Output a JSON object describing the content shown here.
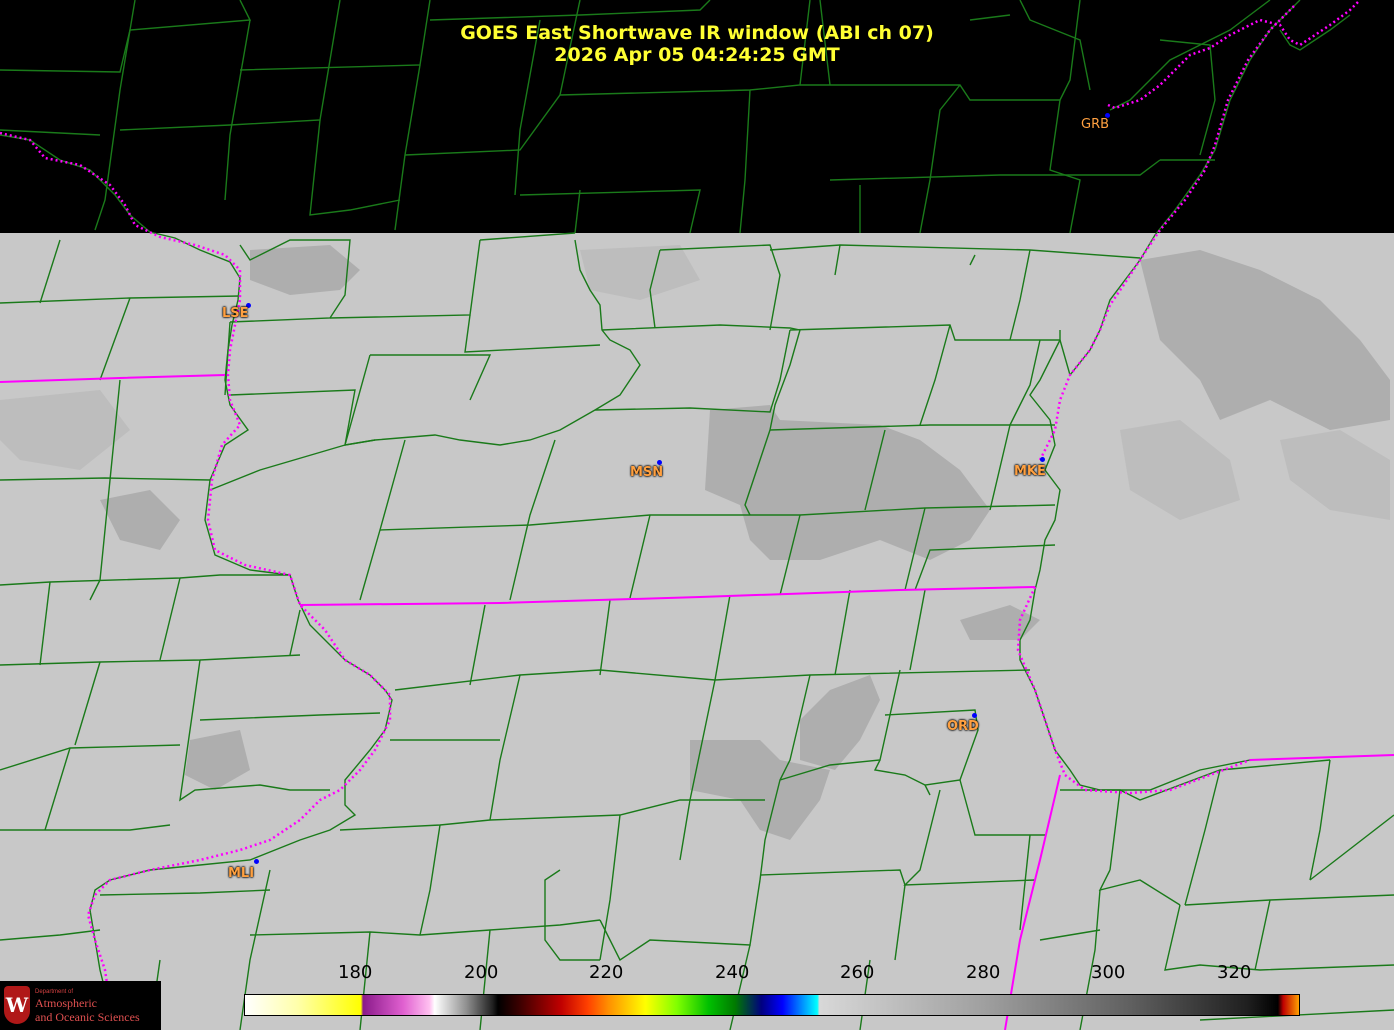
{
  "title": {
    "line1": "GOES East Shortwave IR window (ABI ch 07)",
    "line2": "2026 Apr 05  04:24:25 GMT"
  },
  "cities": [
    {
      "code": "GRB"
    },
    {
      "code": "LSE"
    },
    {
      "code": "MSN"
    },
    {
      "code": "MKE"
    },
    {
      "code": "ORD"
    },
    {
      "code": "MLI"
    }
  ],
  "colorbar": {
    "tick_labels": [
      "180",
      "200",
      "220",
      "240",
      "260",
      "280",
      "300",
      "320"
    ]
  },
  "colors": {
    "county_lines": "#1a7a1a",
    "state_lines": "#ff00ff",
    "title": "#ffff33",
    "city_label": "#ffa040",
    "city_dot": "#0000ff",
    "imagery_background": "#c8c8c8"
  },
  "logo": {
    "dept": "Department of",
    "line1": "Atmospheric",
    "line2": "and Oceanic Sciences"
  }
}
